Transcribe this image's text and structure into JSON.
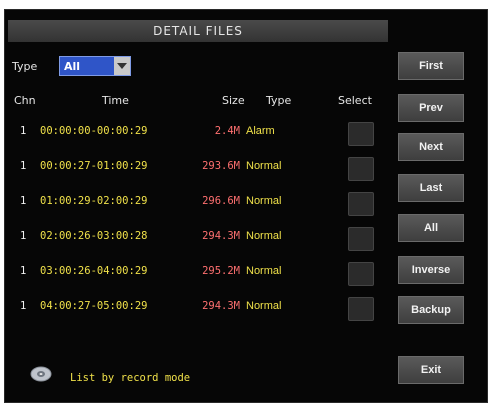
{
  "window": {
    "title": "DETAIL FILES"
  },
  "filter": {
    "label": "Type",
    "selected": "All"
  },
  "columns": {
    "chn": "Chn",
    "time": "Time",
    "size": "Size",
    "type": "Type",
    "select": "Select"
  },
  "rows": [
    {
      "chn": "1",
      "time": "00:00:00-00:00:29",
      "size": "2.4M",
      "type": "Alarm"
    },
    {
      "chn": "1",
      "time": "00:00:27-01:00:29",
      "size": "293.6M",
      "type": "Normal"
    },
    {
      "chn": "1",
      "time": "01:00:29-02:00:29",
      "size": "296.6M",
      "type": "Normal"
    },
    {
      "chn": "1",
      "time": "02:00:26-03:00:28",
      "size": "294.3M",
      "type": "Normal"
    },
    {
      "chn": "1",
      "time": "03:00:26-04:00:29",
      "size": "295.2M",
      "type": "Normal"
    },
    {
      "chn": "1",
      "time": "04:00:27-05:00:29",
      "size": "294.3M",
      "type": "Normal"
    }
  ],
  "buttons": {
    "first": "First",
    "prev": "Prev",
    "next": "Next",
    "last": "Last",
    "all": "All",
    "inverse": "Inverse",
    "backup": "Backup",
    "exit": "Exit"
  },
  "footer": {
    "text": "List by record mode",
    "icon": "disc-icon"
  }
}
